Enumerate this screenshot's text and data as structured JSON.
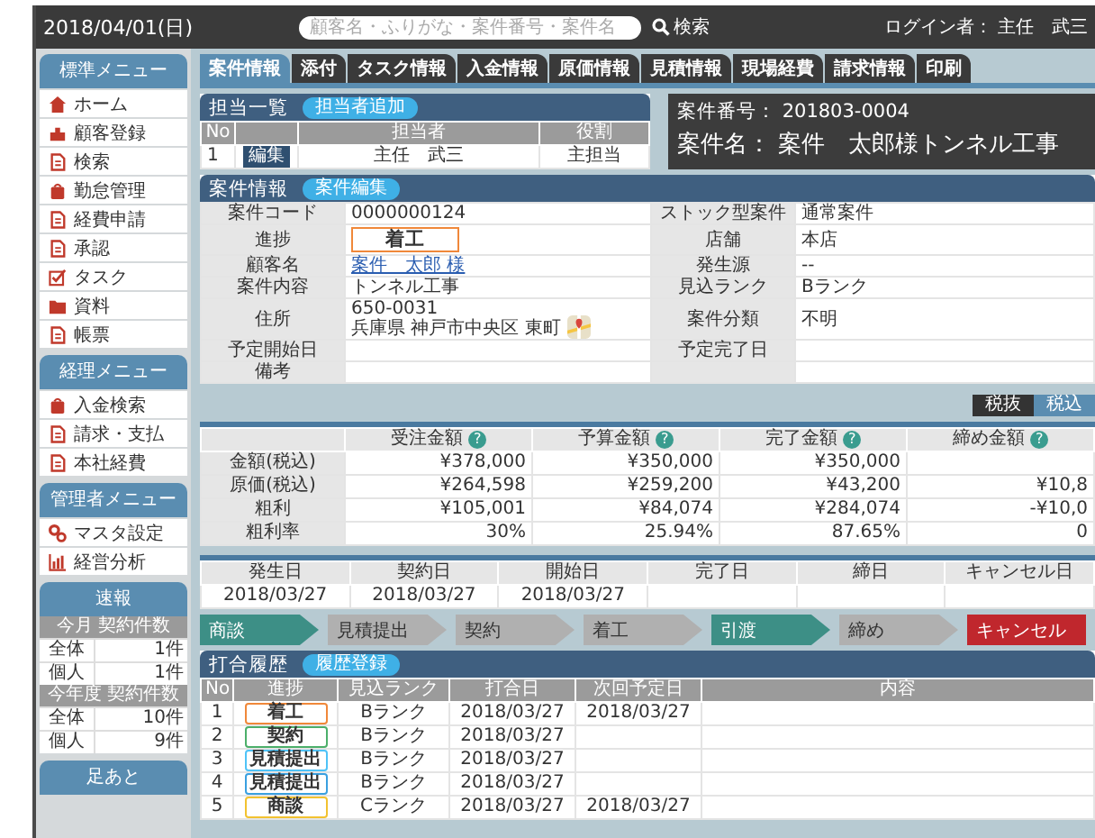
{
  "header": {
    "date": "2018/04/01(日)",
    "search": {
      "placeholder": "顧客名・ふりがな・案件番号・案件名",
      "button": "検索"
    },
    "login": "ログイン者： 主任　武三"
  },
  "sidebar": {
    "menus": [
      {
        "title": "標準メニュー",
        "items": [
          "ホーム",
          "顧客登録",
          "検索",
          "勤怠管理",
          "経費申請",
          "承認",
          "タスク",
          "資料",
          "帳票"
        ]
      },
      {
        "title": "経理メニュー",
        "items": [
          "入金検索",
          "請求・支払",
          "本社経費"
        ]
      },
      {
        "title": "管理者メニュー",
        "items": [
          "マスタ設定",
          "経営分析"
        ]
      }
    ],
    "stats": {
      "title": "速報",
      "groups": [
        {
          "title": "今月 契約件数",
          "rows": [
            {
              "label": "全体",
              "value": "1件"
            },
            {
              "label": "個人",
              "value": "1件"
            }
          ]
        },
        {
          "title": "今年度 契約件数",
          "rows": [
            {
              "label": "全体",
              "value": "10件"
            },
            {
              "label": "個人",
              "value": "9件"
            }
          ]
        }
      ]
    },
    "footprints": {
      "title": "足あと"
    }
  },
  "tabs": [
    {
      "label": "案件情報",
      "selected": true
    },
    {
      "label": "添付",
      "selected": false
    },
    {
      "label": "タスク情報",
      "selected": false
    },
    {
      "label": "入金情報",
      "selected": false
    },
    {
      "label": "原価情報",
      "selected": false
    },
    {
      "label": "見積情報",
      "selected": false
    },
    {
      "label": "現場経費",
      "selected": false
    },
    {
      "label": "請求情報",
      "selected": false
    },
    {
      "label": "印刷",
      "selected": false
    }
  ],
  "assignees": {
    "title": "担当一覧",
    "add_button": "担当者追加",
    "columns": {
      "no": "No",
      "name": "担当者",
      "role": "役割"
    },
    "rows": [
      {
        "no": "1",
        "edit": "編集",
        "name": "主任　武三",
        "role": "主担当"
      }
    ]
  },
  "case_header": {
    "number_label": "案件番号：",
    "number": "201803-0004",
    "name_label": "案件名：",
    "name": "案件　太郎様トンネル工事"
  },
  "case_info": {
    "title": "案件情報",
    "edit_button": "案件編集",
    "rows": [
      {
        "left": {
          "label": "案件コード",
          "value": "0000000124"
        },
        "right": {
          "label": "ストック型案件",
          "value": "通常案件"
        }
      },
      {
        "left": {
          "label": "進捗",
          "kind": "badge",
          "value": "着工",
          "color": "#f0883a"
        },
        "right": {
          "label": "店舗",
          "value": "本店"
        }
      },
      {
        "left": {
          "label": "顧客名",
          "kind": "link",
          "value": "案件　太郎 様"
        },
        "right": {
          "label": "発生源",
          "value": "--"
        }
      },
      {
        "left": {
          "label": "案件内容",
          "value": "トンネル工事"
        },
        "right": {
          "label": "見込ランク",
          "value": "Bランク"
        }
      },
      {
        "left": {
          "label": "住所",
          "kind": "address",
          "lines": [
            "650-0031",
            "兵庫県 神戸市中央区 東町"
          ]
        },
        "right": {
          "label": "案件分類",
          "value": "不明"
        }
      },
      {
        "left": {
          "label": "予定開始日"
        },
        "right": {
          "label": "予定完了日"
        }
      },
      {
        "left": {
          "label": "備考"
        }
      }
    ]
  },
  "money": {
    "toggle": [
      {
        "label": "税抜",
        "selected": true
      },
      {
        "label": "税込",
        "selected": false
      }
    ],
    "columns": [
      {
        "label": "受注金額",
        "help": "?"
      },
      {
        "label": "予算金額",
        "help": "?"
      },
      {
        "label": "完了金額",
        "help": "?"
      },
      {
        "label": "締め金額",
        "help": "?"
      }
    ],
    "rows": [
      {
        "label": "金額(税込)",
        "values": [
          "¥378,000",
          "¥350,000",
          "¥350,000"
        ]
      },
      {
        "label": "原価(税込)",
        "values": [
          "¥264,598",
          "¥259,200",
          "¥43,200",
          "¥10,8"
        ]
      },
      {
        "label": "粗利",
        "values": [
          "¥105,001",
          "¥84,074",
          "¥284,074",
          "-¥10,0"
        ]
      },
      {
        "label": "粗利率",
        "values": [
          "30%",
          "25.94%",
          "87.65%",
          "0"
        ]
      }
    ]
  },
  "dates": {
    "columns": [
      "発生日",
      "契約日",
      "開始日",
      "完了日",
      "締日",
      "キャンセル日"
    ],
    "values": [
      "2018/03/27",
      "2018/03/27",
      "2018/03/27"
    ]
  },
  "progress": [
    {
      "label": "商談",
      "kind": "step",
      "selected": true
    },
    {
      "label": "見積提出",
      "kind": "step",
      "selected": false
    },
    {
      "label": "契約",
      "kind": "step",
      "selected": false
    },
    {
      "label": "着工",
      "kind": "step",
      "selected": false
    },
    {
      "label": "引渡",
      "kind": "step",
      "selected": true
    },
    {
      "label": "締め",
      "kind": "step",
      "selected": false
    },
    {
      "label": "キャンセル",
      "kind": "cancel",
      "selected": false
    }
  ],
  "history": {
    "title": "打合履歴",
    "add_button": "履歴登録",
    "columns": [
      "No",
      "進捗",
      "見込ランク",
      "打合日",
      "次回予定日",
      "内容"
    ],
    "rows": [
      {
        "no": "1",
        "status": "着工",
        "color": "#f0883a",
        "rank": "Bランク",
        "date": "2018/03/27",
        "next": "2018/03/27"
      },
      {
        "no": "2",
        "status": "契約",
        "color": "#4caf6a",
        "rank": "Bランク",
        "date": "2018/03/27"
      },
      {
        "no": "3",
        "status": "見積提出",
        "color": "#4fc3f7",
        "rank": "Bランク",
        "date": "2018/03/27"
      },
      {
        "no": "4",
        "status": "見積提出",
        "color": "#3aa0e0",
        "rank": "Bランク",
        "date": "2018/03/27"
      },
      {
        "no": "5",
        "status": "商談",
        "color": "#f2c230",
        "rank": "Cランク",
        "date": "2018/03/27",
        "next": "2018/03/27"
      }
    ]
  }
}
